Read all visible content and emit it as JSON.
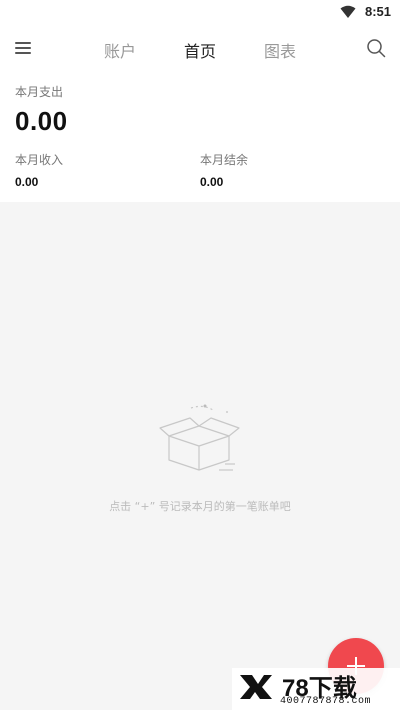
{
  "status_bar": {
    "time": "8:51",
    "wifi_icon": "wifi-icon"
  },
  "nav": {
    "menu_icon": "menu-icon",
    "tabs": [
      {
        "label": "账户",
        "active": false
      },
      {
        "label": "首页",
        "active": true
      },
      {
        "label": "图表",
        "active": false
      }
    ],
    "search_icon": "search-icon"
  },
  "summary": {
    "expense_label": "本月支出",
    "expense_value": "0.00",
    "income_label": "本月收入",
    "income_value": "0.00",
    "balance_label": "本月结余",
    "balance_value": "0.00"
  },
  "empty_state": {
    "icon": "empty-box-icon",
    "message": "点击 “+” 号记录本月的第一笔账单吧"
  },
  "fab": {
    "icon": "plus-icon",
    "color": "#f0484e"
  },
  "watermark": {
    "brand": "78下载",
    "url": "4007787878.com"
  }
}
